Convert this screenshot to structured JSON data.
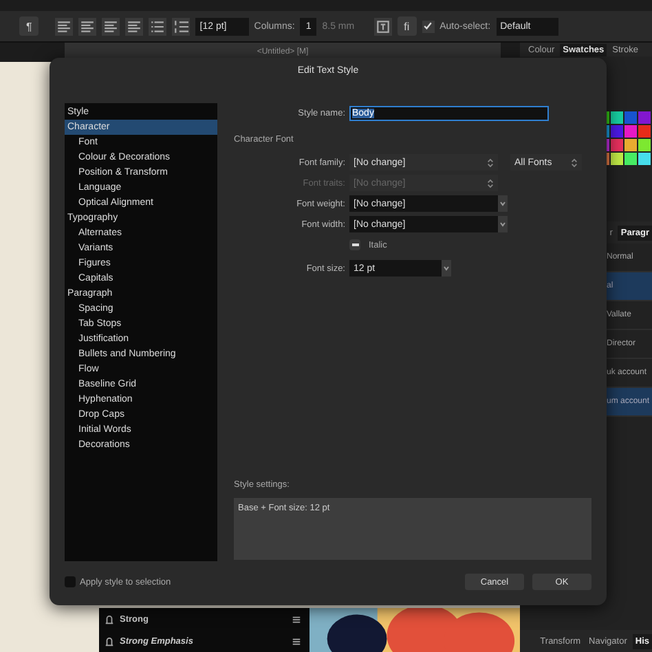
{
  "toolbar": {
    "paragraph_button": "¶",
    "font_size": "[12 pt]",
    "columns_label": "Columns:",
    "columns": "1",
    "gutter": "8.5 mm",
    "ligature_button": "fi",
    "auto_select": {
      "label": "Auto-select:",
      "checked": true
    },
    "auto_select_value": "Default"
  },
  "document": {
    "title": "<Untitled> [M]"
  },
  "right_panel": {
    "tabs": [
      {
        "label": "Colour",
        "selected": false
      },
      {
        "label": "Swatches",
        "selected": true
      },
      {
        "label": "Stroke",
        "selected": false
      }
    ],
    "text_tabs": [
      {
        "label": "r",
        "selected": false
      },
      {
        "label": "Paragr",
        "selected": true
      }
    ],
    "styles": [
      {
        "label": "Normal",
        "selected": false
      },
      {
        "label": "al",
        "selected": true
      },
      {
        "label": "Vallate",
        "selected": false
      },
      {
        "label": "Director",
        "selected": false
      },
      {
        "label": "uk account",
        "selected": false
      },
      {
        "label": "um account",
        "selected": true
      }
    ],
    "bottom_tabs": [
      {
        "label": "Transform",
        "selected": false
      },
      {
        "label": "Navigator",
        "selected": false
      },
      {
        "label": "His",
        "selected": true
      }
    ]
  },
  "styles_panel": {
    "items": [
      {
        "name": "Strong",
        "italic": false
      },
      {
        "name": "Strong Emphasis",
        "italic": true
      }
    ]
  },
  "dialog": {
    "title": "Edit Text Style",
    "categories": [
      {
        "label": "Style",
        "selected": false
      },
      {
        "label": "Character",
        "selected": true,
        "children": [
          {
            "label": "Font",
            "selected": false
          },
          {
            "label": "Colour & Decorations",
            "selected": false
          },
          {
            "label": "Position & Transform",
            "selected": false
          },
          {
            "label": "Language",
            "selected": false
          },
          {
            "label": "Optical Alignment",
            "selected": false
          }
        ]
      },
      {
        "label": "Typography",
        "selected": false,
        "children": [
          {
            "label": "Alternates",
            "selected": false
          },
          {
            "label": "Variants",
            "selected": false
          },
          {
            "label": "Figures",
            "selected": false
          },
          {
            "label": "Capitals",
            "selected": false
          }
        ]
      },
      {
        "label": "Paragraph",
        "selected": false,
        "children": [
          {
            "label": "Spacing",
            "selected": false
          },
          {
            "label": "Tab Stops",
            "selected": false
          },
          {
            "label": "Justification",
            "selected": false
          },
          {
            "label": "Bullets and Numbering",
            "selected": false
          },
          {
            "label": "Flow",
            "selected": false
          },
          {
            "label": "Baseline Grid",
            "selected": false
          },
          {
            "label": "Hyphenation",
            "selected": false
          },
          {
            "label": "Drop Caps",
            "selected": false
          },
          {
            "label": "Initial Words",
            "selected": false
          },
          {
            "label": "Decorations",
            "selected": false
          }
        ]
      }
    ],
    "style_name": {
      "label": "Style name:",
      "value": "Body"
    },
    "section": "Character Font",
    "rows": [
      {
        "kind": "popup",
        "label": "Font family:",
        "value": "[No change]",
        "disabled": false,
        "extra": "All Fonts"
      },
      {
        "kind": "popup",
        "label": "Font traits:",
        "value": "[No change]",
        "disabled": true
      },
      {
        "kind": "combo",
        "label": "Font weight:",
        "value": "[No change]",
        "disabled": false
      },
      {
        "kind": "combo",
        "label": "Font width:",
        "value": "[No change]",
        "disabled": false
      },
      {
        "kind": "checkbox",
        "label": "Italic",
        "indeterminate": true
      },
      {
        "kind": "size",
        "label": "Font size:",
        "value": "12 pt",
        "disabled": false
      }
    ],
    "settings_label": "Style settings:",
    "settings": "Base + Font size: 12 pt",
    "apply": {
      "label": "Apply style to selection",
      "checked": false
    },
    "buttons": [
      "Cancel",
      "OK"
    ]
  }
}
